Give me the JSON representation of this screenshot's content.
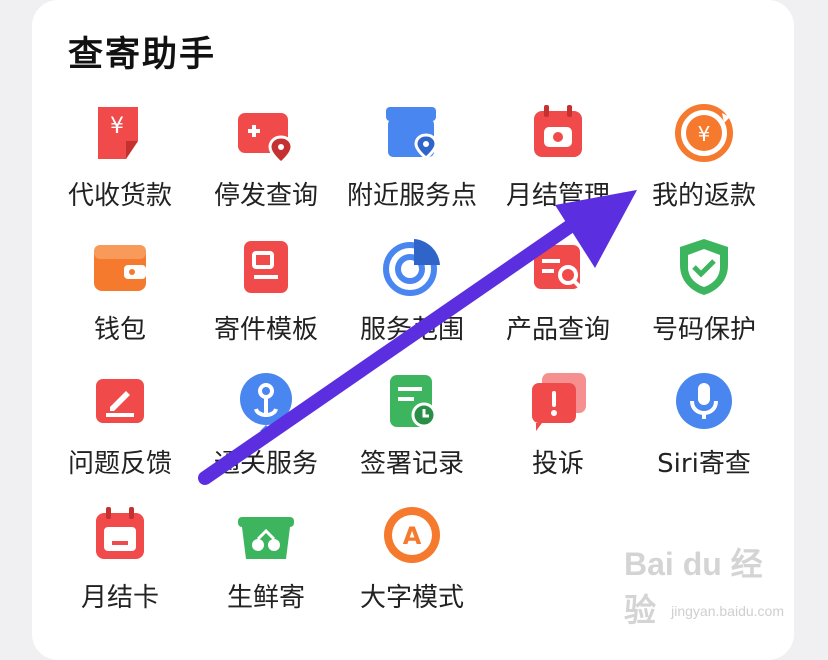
{
  "section_title": "查寄助手",
  "items": [
    {
      "label": "代收货款",
      "icon": "payment-collection-icon"
    },
    {
      "label": "停发查询",
      "icon": "stop-shipping-icon"
    },
    {
      "label": "附近服务点",
      "icon": "nearby-service-icon"
    },
    {
      "label": "月结管理",
      "icon": "monthly-settlement-icon"
    },
    {
      "label": "我的返款",
      "icon": "refund-icon"
    },
    {
      "label": "钱包",
      "icon": "wallet-icon"
    },
    {
      "label": "寄件模板",
      "icon": "template-icon"
    },
    {
      "label": "服务范围",
      "icon": "service-range-icon"
    },
    {
      "label": "产品查询",
      "icon": "product-query-icon"
    },
    {
      "label": "号码保护",
      "icon": "number-protect-icon"
    },
    {
      "label": "问题反馈",
      "icon": "feedback-icon"
    },
    {
      "label": "通关服务",
      "icon": "customs-icon"
    },
    {
      "label": "签署记录",
      "icon": "sign-record-icon"
    },
    {
      "label": "投诉",
      "icon": "complaint-icon"
    },
    {
      "label": "Siri寄查",
      "icon": "siri-mic-icon"
    },
    {
      "label": "月结卡",
      "icon": "monthly-card-icon"
    },
    {
      "label": "生鲜寄",
      "icon": "fresh-basket-icon"
    },
    {
      "label": "大字模式",
      "icon": "large-font-icon"
    }
  ],
  "colors": {
    "red": "#f04a4a",
    "blue": "#4a86f0",
    "orange": "#f57a2e",
    "green": "#3cb55e",
    "arrow": "#5b2ee0"
  },
  "watermark": {
    "brand": "Bai du 经验",
    "url": "jingyan.baidu.com"
  }
}
